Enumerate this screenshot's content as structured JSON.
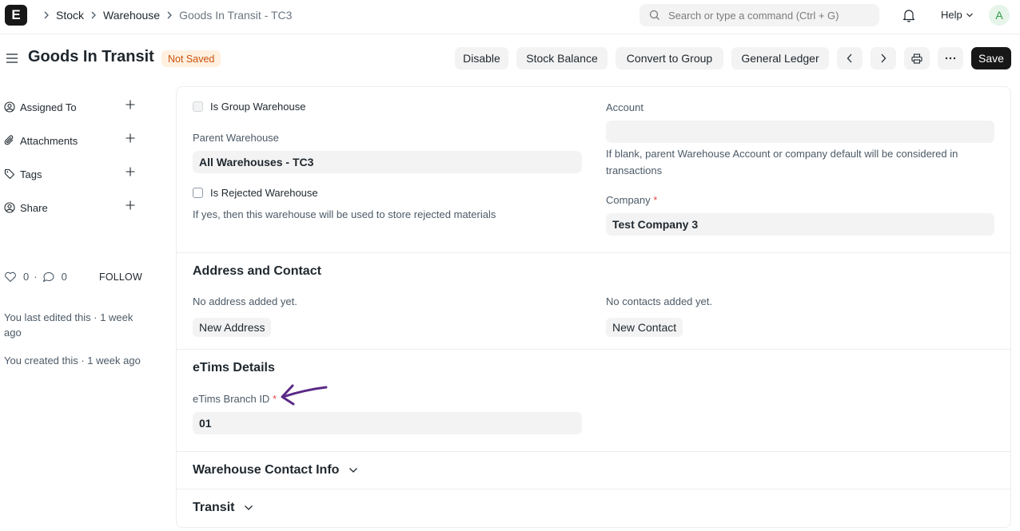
{
  "navbar": {
    "logo_letter": "E",
    "breadcrumbs": [
      "Stock",
      "Warehouse",
      "Goods In Transit - TC3"
    ],
    "search_placeholder": "Search or type a command (Ctrl + G)",
    "help_label": "Help",
    "avatar_letter": "A"
  },
  "page": {
    "title": "Goods In Transit",
    "status": "Not Saved",
    "actions": {
      "disable": "Disable",
      "stock_balance": "Stock Balance",
      "convert_to_group": "Convert to Group",
      "general_ledger": "General Ledger",
      "save": "Save"
    }
  },
  "sidebar": {
    "items": [
      {
        "label": "Assigned To"
      },
      {
        "label": "Attachments"
      },
      {
        "label": "Tags"
      },
      {
        "label": "Share"
      }
    ],
    "likes": "0",
    "comments": "0",
    "follow_label": "FOLLOW",
    "last_edited": "You last edited this · 1 week ago",
    "created": "You created this · 1 week ago"
  },
  "form": {
    "is_group_label": "Is Group Warehouse",
    "parent_warehouse_label": "Parent Warehouse",
    "parent_warehouse_value": "All Warehouses - TC3",
    "is_rejected_label": "Is Rejected Warehouse",
    "is_rejected_hint": "If yes, then this warehouse will be used to store rejected materials",
    "account_label": "Account",
    "account_value": "",
    "account_hint": "If blank, parent Warehouse Account or company default will be considered in transactions",
    "company_label": "Company",
    "company_value": "Test Company 3",
    "required_mark": "*"
  },
  "address_section": {
    "title": "Address and Contact",
    "no_address": "No address added yet.",
    "new_address": "New Address",
    "no_contacts": "No contacts added yet.",
    "new_contact": "New Contact"
  },
  "etims_section": {
    "title": "eTims Details",
    "branch_id_label": "eTims Branch ID",
    "branch_id_value": "01"
  },
  "collapsed_sections": {
    "warehouse_contact_info": "Warehouse Contact Info",
    "transit": "Transit"
  },
  "colors": {
    "primary_button": "#171717",
    "status_badge_bg": "#fff0e0",
    "status_badge_text": "#c9520b",
    "annotation_arrow": "#5b2a86"
  }
}
